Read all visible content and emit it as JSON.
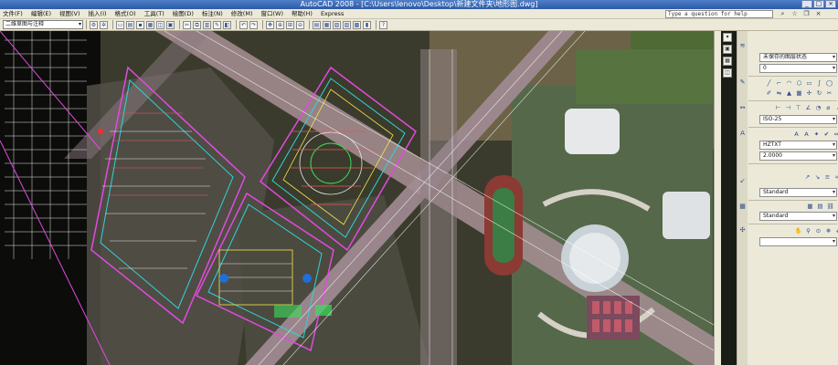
{
  "titlebar": {
    "title": "AutoCAD 2008 - [C:\\Users\\lenovo\\Desktop\\新建文件夹\\地形图.dwg]",
    "min": "_",
    "max": "□",
    "close": "×"
  },
  "menu": [
    "文件(F)",
    "编辑(E)",
    "视图(V)",
    "插入(I)",
    "格式(O)",
    "工具(T)",
    "绘图(D)",
    "标注(N)",
    "修改(M)",
    "窗口(W)",
    "帮助(H)",
    "Express"
  ],
  "help": {
    "placeholder": "Type a question for help"
  },
  "toolbar": {
    "workspace": "二维草图与注释"
  },
  "palette": {
    "layer_state": "未保存的图层状态",
    "layer": "0",
    "dimstyle": "ISO-25",
    "textstyle": "HZTXT",
    "textheight": "2.0000",
    "tablestyle": "Standard",
    "mleaderstyle": "Standard",
    "extra": ""
  },
  "colors": {
    "titlebar": "#2c5aa6",
    "chrome": "#ece9d8",
    "road": "#b89aa6",
    "cad_cyan": "#2fd4d8",
    "cad_magenta": "#e24ae0"
  }
}
